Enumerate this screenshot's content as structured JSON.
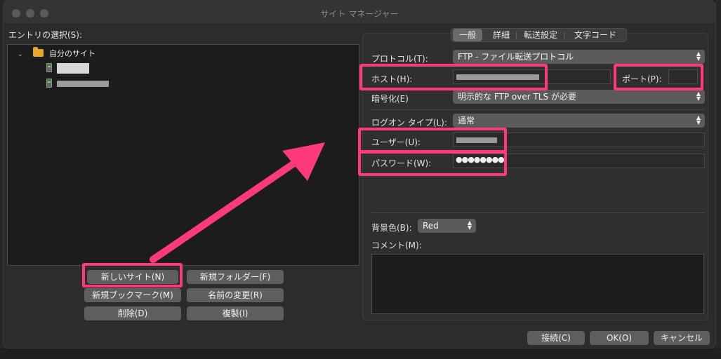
{
  "window": {
    "title": "サイト マネージャー"
  },
  "left": {
    "entry_label": "エントリの選択(S):",
    "tree": {
      "root_label": "自分のサイト"
    }
  },
  "buttons": {
    "new_site": "新しいサイト(N)",
    "new_folder": "新規フォルダー(F)",
    "new_bookmark": "新規ブックマーク(M)",
    "rename": "名前の変更(R)",
    "delete": "削除(D)",
    "duplicate": "複製(I)",
    "connect": "接続(C)",
    "ok": "OK(O)",
    "cancel": "キャンセル"
  },
  "tabs": [
    "一般",
    "詳細",
    "転送設定",
    "文字コード"
  ],
  "general": {
    "protocol_label": "プロトコル(T):",
    "protocol_value": "FTP - ファイル転送プロトコル",
    "host_label": "ホスト(H):",
    "port_label": "ポート(P):",
    "encryption_label": "暗号化(E)",
    "encryption_value": "明示的な FTP over TLS が必要",
    "logon_label": "ログオン タイプ(L):",
    "logon_value": "通常",
    "user_label": "ユーザー(U):",
    "password_label": "パスワード(W):",
    "password_value": "●●●●●●●●",
    "bgcolor_label": "背景色(B):",
    "bgcolor_value": "Red",
    "comment_label": "コメント(M):"
  },
  "colors": {
    "highlight": "#ff3a7a",
    "folder": "#e9a72a"
  }
}
